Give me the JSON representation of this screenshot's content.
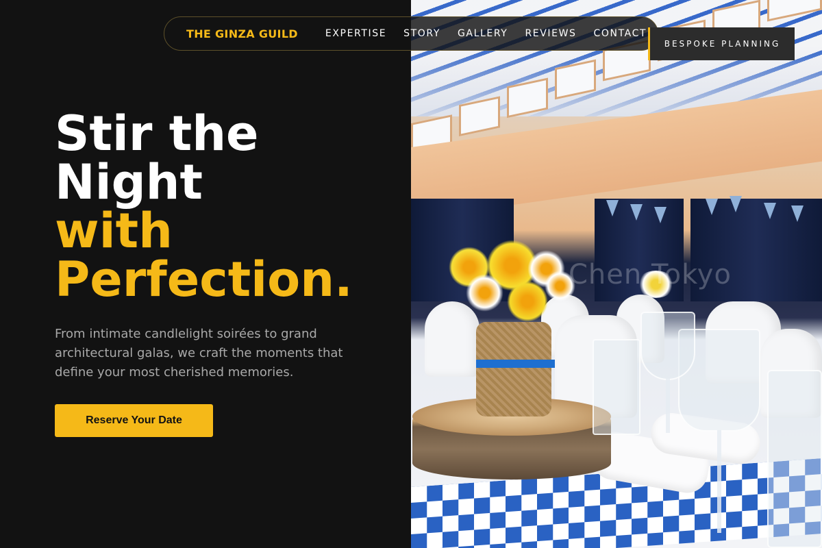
{
  "nav": {
    "brand": "THE GINZA GUILD",
    "links": [
      "EXPERTISE",
      "STORY",
      "GALLERY",
      "REVIEWS",
      "CONTACT"
    ],
    "cta": "BESPOKE PLANNING"
  },
  "hero": {
    "title_line1": "Stir the",
    "title_line2": "Night",
    "title_accent1": "with",
    "title_accent2": "Perfection.",
    "description": "From intimate candlelight soirées to grand architectural galas, we craft the moments that define your most cherished memories.",
    "button": "Reserve Your Date"
  },
  "image": {
    "watermark": "Chen Tokyo"
  },
  "colors": {
    "accent": "#f5b918",
    "background": "#121212",
    "text_muted": "#a9a9a9"
  }
}
